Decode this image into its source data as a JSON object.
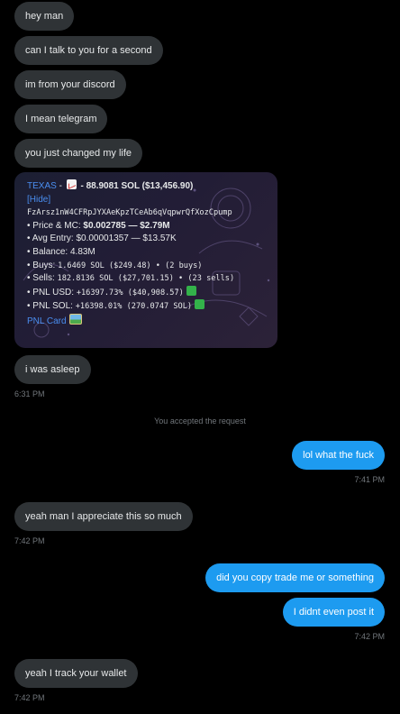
{
  "messages_top": [
    {
      "text": "hey man"
    },
    {
      "text": "can I talk to you for a second"
    },
    {
      "text": "im from your discord"
    },
    {
      "text": "I mean telegram"
    },
    {
      "text": "you just changed my life"
    }
  ],
  "card": {
    "token_name": "TEXAS",
    "sep": " - ",
    "chart_icon": "chart-increasing-icon",
    "sol_summary": " - 88.9081 SOL ($13,456.90)",
    "hide_link": "[Hide]",
    "address": "FzArsz1nW4CFRpJYXAeKpzTCeAb6qVqpwrQfXozCpump",
    "price_label": "• Price & MC: ",
    "price_value": "$0.002785 — $2.79M",
    "avg_entry": "• Avg Entry: $0.00001357 — $13.57K",
    "balance": "• Balance: 4.83M",
    "buys_label": "• Buys: ",
    "buys_value": "1.6469 SOL ($249.48) • (2 buys)",
    "sells_label": "• Sells: ",
    "sells_value": "182.8136 SOL ($27,701.15) • (23 sells)",
    "pnl_usd_label": "• PNL USD: ",
    "pnl_usd_value": "+16397.73% ($40,908.57)",
    "pnl_sol_label": "• PNL SOL: ",
    "pnl_sol_value": "+16398.01% (270.0747 SOL)",
    "pnl_card_link": "PNL Card",
    "pnl_card_icon": "framed-picture-icon",
    "status_icon": "green-square-icon"
  },
  "msg_asleep": "i was asleep",
  "ts_1": "6:31 PM",
  "notice": "You accepted the request",
  "msg_right_1": "lol what the fuck",
  "ts_2": "7:41 PM",
  "msg_left_appreciate": "yeah man I appreciate this so much",
  "ts_3": "7:42 PM",
  "msg_right_2": "did you copy trade me or something",
  "msg_right_3": "I didnt even post it",
  "ts_4": "7:42 PM",
  "msg_left_track": "yeah I track your wallet",
  "ts_5": "7:42 PM",
  "colors": {
    "background": "#000000",
    "incoming_bubble": "#2f3336",
    "outgoing_bubble": "#1d9bf0",
    "link": "#4a8ef0",
    "timestamp": "#71767b"
  }
}
